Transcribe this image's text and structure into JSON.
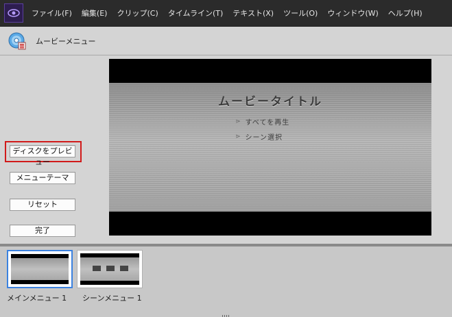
{
  "app": {
    "logo_icon": "premiere-elements-logo-icon"
  },
  "menubar": {
    "items": [
      {
        "label": "ファイル(F)"
      },
      {
        "label": "編集(E)"
      },
      {
        "label": "クリップ(C)"
      },
      {
        "label": "タイムライン(T)"
      },
      {
        "label": "テキスト(X)"
      },
      {
        "label": "ツール(O)"
      },
      {
        "label": "ウィンドウ(W)"
      },
      {
        "label": "ヘルプ(H)"
      }
    ]
  },
  "panel": {
    "title": "ムービーメニュー",
    "icon": "disc-menu-icon"
  },
  "sidebar": {
    "preview_disc": "ディスクをプレビュー",
    "menu_theme": "メニューテーマ",
    "reset": "リセット",
    "done": "完了"
  },
  "preview": {
    "title": "ムービータイトル",
    "links": [
      "すべてを再生",
      "シーン選択"
    ]
  },
  "thumbnails": [
    {
      "label": "メインメニュー 1",
      "selected": true
    },
    {
      "label": "シーンメニュー 1",
      "selected": false
    }
  ],
  "colors": {
    "highlight": "#d11a1a",
    "selection": "#3b82e0",
    "menubar": "#2b2b2b"
  }
}
